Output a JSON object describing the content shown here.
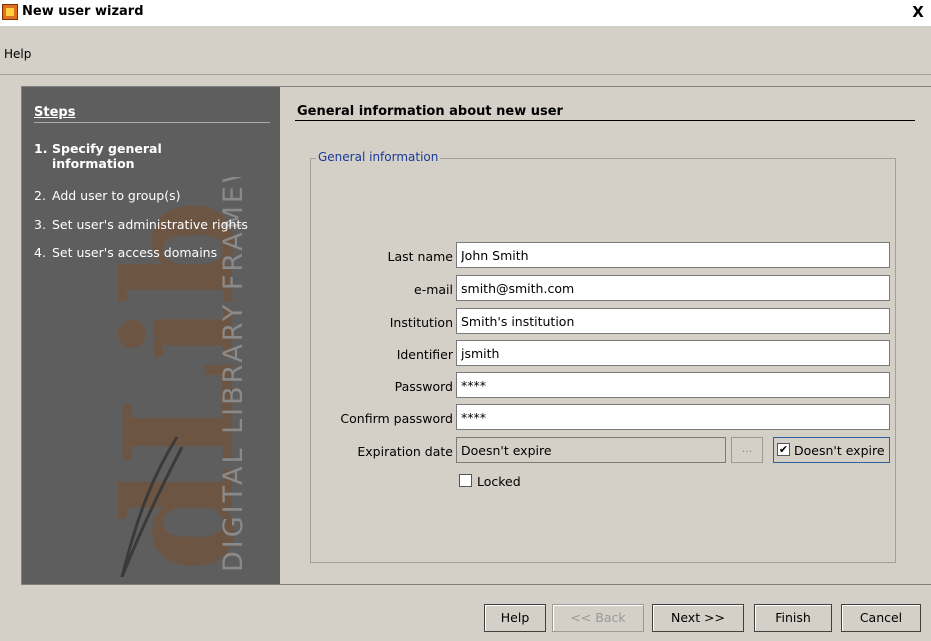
{
  "window": {
    "title": "New user wizard",
    "close_glyph": "X"
  },
  "menu": {
    "help": "Help"
  },
  "steps": {
    "title": "Steps",
    "items": [
      {
        "num": "1.",
        "label": "Specify general information",
        "active": true
      },
      {
        "num": "2.",
        "label": "Add user to group(s)",
        "active": false
      },
      {
        "num": "3.",
        "label": "Set user's administrative rights",
        "active": false
      },
      {
        "num": "4.",
        "label": "Set user's access domains",
        "active": false
      }
    ],
    "watermark_brand": "dLib",
    "watermark_tagline": "DIGITAL LIBRARY FRAMEWORK"
  },
  "section": {
    "title": "General information about new user",
    "group_title": "General information"
  },
  "form": {
    "last_name": {
      "label": "Last name",
      "value": "John Smith"
    },
    "email": {
      "label": "e-mail",
      "value": "smith@smith.com"
    },
    "institution": {
      "label": "Institution",
      "value": "Smith's institution"
    },
    "identifier": {
      "label": "Identifier",
      "value": "jsmith"
    },
    "password": {
      "label": "Password",
      "value": "****"
    },
    "confirm_password": {
      "label": "Confirm password",
      "value": "****"
    },
    "expiration": {
      "label": "Expiration date",
      "value": "Doesn't expire",
      "picker": "...",
      "doesnt_expire_label": "Doesn't expire",
      "doesnt_expire_checked": true
    },
    "locked": {
      "label": "Locked",
      "checked": false
    }
  },
  "buttons": {
    "help": "Help",
    "back": "<< Back",
    "next": "Next >>",
    "finish": "Finish",
    "cancel": "Cancel"
  }
}
